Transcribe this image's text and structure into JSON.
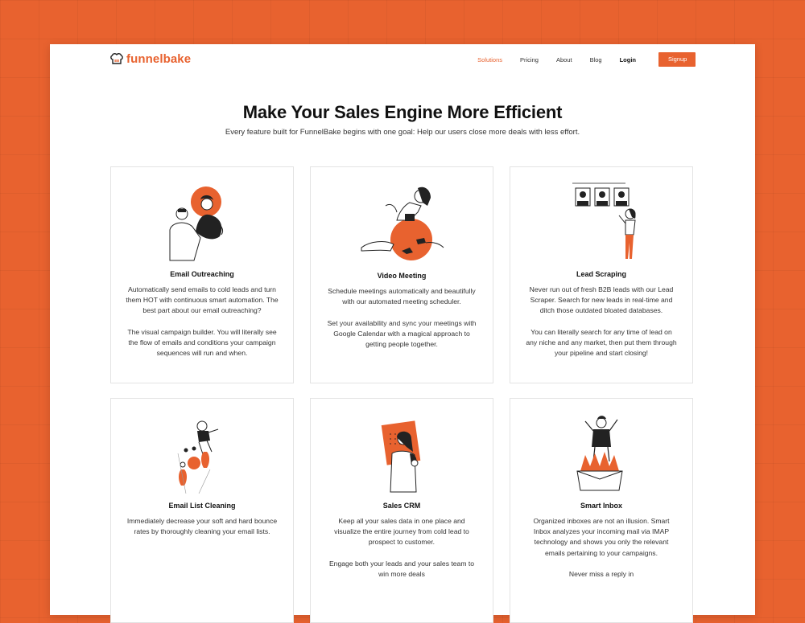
{
  "brand": {
    "name": "funnelbake",
    "accent": "#e8622f"
  },
  "nav": {
    "items": [
      "Solutions",
      "Pricing",
      "About",
      "Blog"
    ],
    "login": "Login",
    "signup": "Signup"
  },
  "hero": {
    "title": "Make Your Sales Engine More Efficient",
    "subtitle": "Every feature built for FunnelBake begins with one goal: Help our users close more deals with less effort."
  },
  "cards": [
    {
      "icon": "email-outreach-illustration",
      "title": "Email Outreaching",
      "desc": "Automatically send emails to cold leads and turn them HOT with continuous smart automation. The best part about our email outreaching?\n\nThe visual campaign builder. You will literally see the flow of emails and conditions your campaign sequences will run and when."
    },
    {
      "icon": "video-meeting-illustration",
      "title": "Video Meeting",
      "desc": "Schedule meetings automatically and beautifully with our automated meeting scheduler.\n\nSet your availability and sync your meetings with Google Calendar with a magical approach to getting people together."
    },
    {
      "icon": "lead-scraping-illustration",
      "title": "Lead Scraping",
      "desc": "Never run out of fresh B2B leads with our Lead Scraper. Search for new leads in real-time and ditch those outdated bloated databases.\n\nYou can literally search for any time of lead on any niche and any market, then put them through your pipeline and start closing!"
    },
    {
      "icon": "email-list-cleaning-illustration",
      "title": "Email List Cleaning",
      "desc": "Immediately decrease your soft and hard bounce rates by thoroughly cleaning your email lists."
    },
    {
      "icon": "sales-crm-illustration",
      "title": "Sales CRM",
      "desc": "Keep all your sales data in one place and visualize the entire journey from cold lead to prospect to customer.\n\nEngage both your leads and your sales team to win more deals"
    },
    {
      "icon": "smart-inbox-illustration",
      "title": "Smart Inbox",
      "desc": "Organized inboxes are not an illusion. Smart Inbox analyzes your incoming mail via IMAP technology and shows you only the relevant emails pertaining to your campaigns.\n\nNever miss a reply in"
    }
  ]
}
